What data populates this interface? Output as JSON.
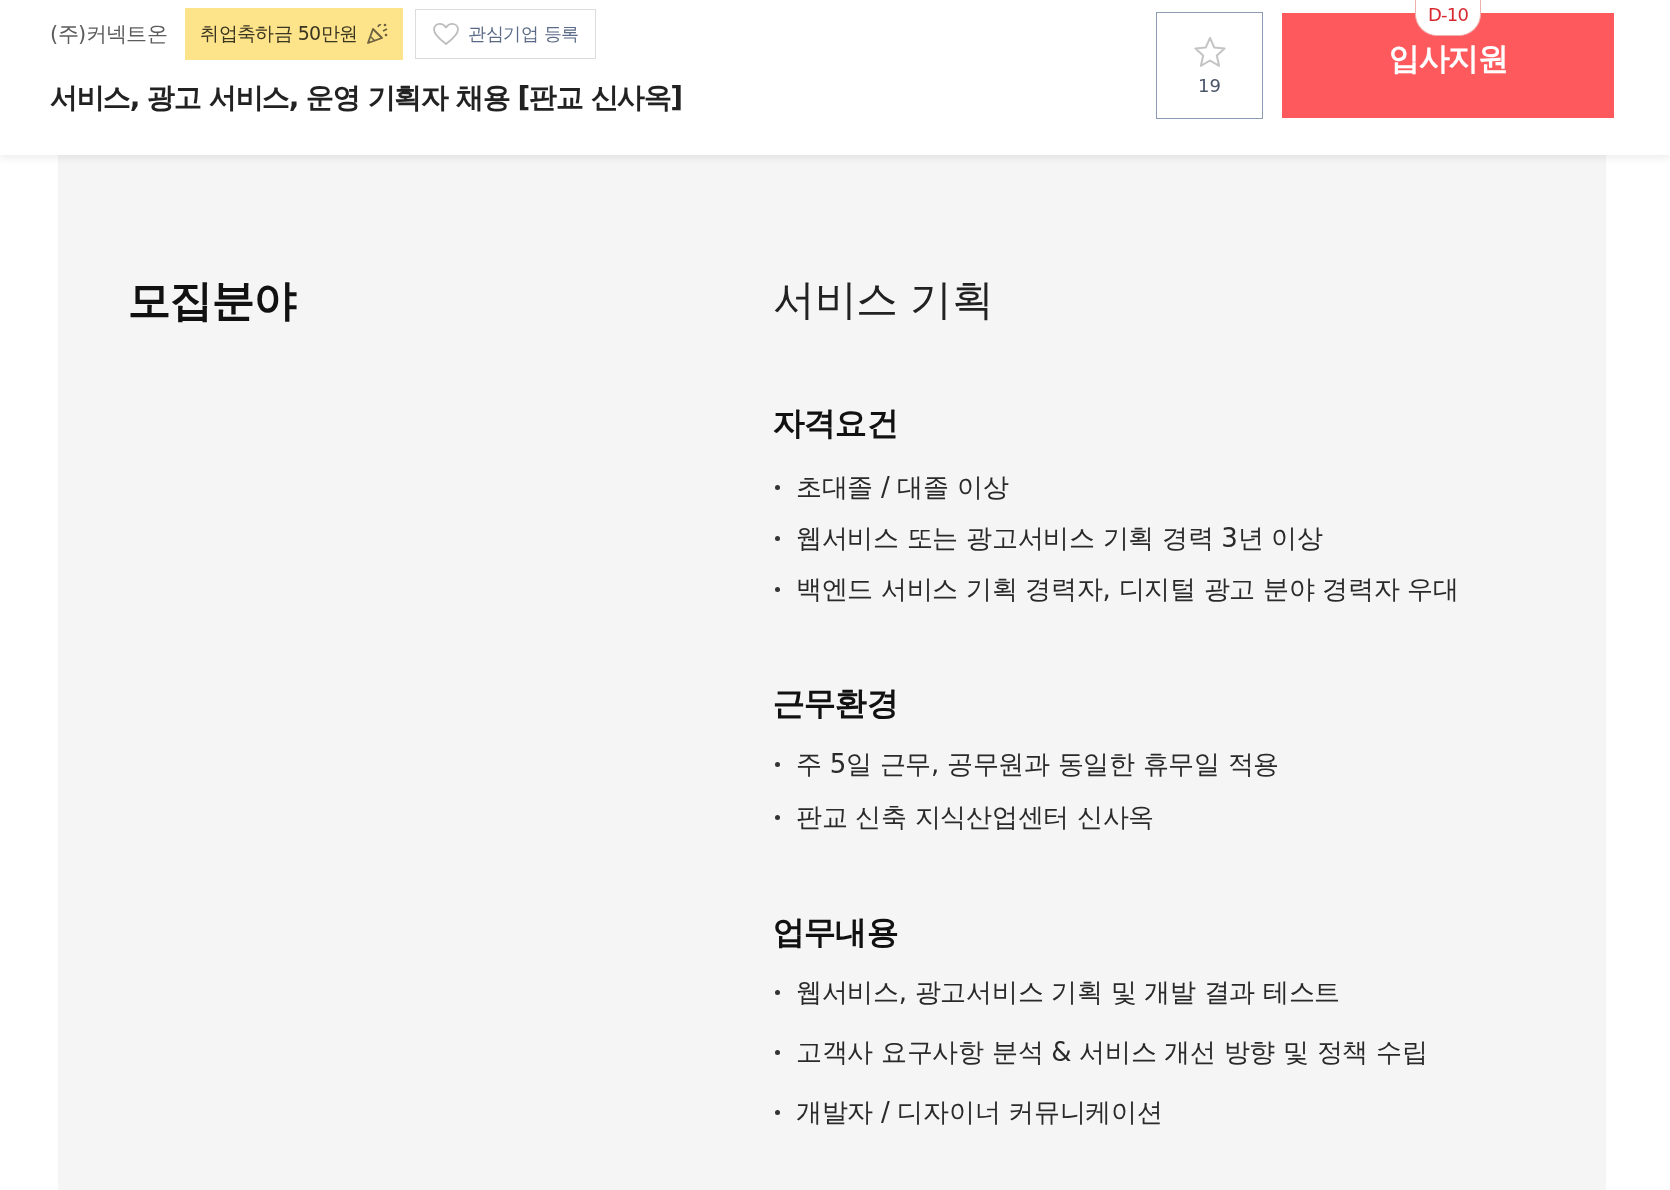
{
  "header": {
    "company": "(주)커넥트온",
    "bonus_badge": "취업축하금 50만원",
    "follow_button": {
      "label": "관심기업 등록",
      "on": false
    },
    "job_title": "서비스, 광고 서비스, 운영 기획자 채용 [판교 신사옥]",
    "bookmark": {
      "count": "19",
      "on": false
    },
    "apply_button": {
      "label": "입사지원",
      "deadline": "D-10"
    }
  },
  "detail": {
    "heading": "모집분야",
    "position": "서비스 기획",
    "sections": [
      {
        "title": "자격요건",
        "items": [
          "초대졸 / 대졸 이상",
          "웹서비스 또는 광고서비스 기획 경력 3년 이상",
          "백엔드 서비스 기획 경력자, 디지털 광고 분야 경력자 우대"
        ]
      },
      {
        "title": "근무환경",
        "items": [
          "주 5일 근무, 공무원과 동일한 휴무일 적용",
          "판교 신축 지식산업센터 신사옥"
        ]
      },
      {
        "title": "업무내용",
        "items": [
          "웹서비스, 광고서비스 기획 및 개발 결과 테스트",
          "고객사 요구사항 분석 & 서비스 개선 방향 및 정책 수립",
          "개발자 / 디자이너 커뮤니케이션"
        ]
      }
    ]
  }
}
